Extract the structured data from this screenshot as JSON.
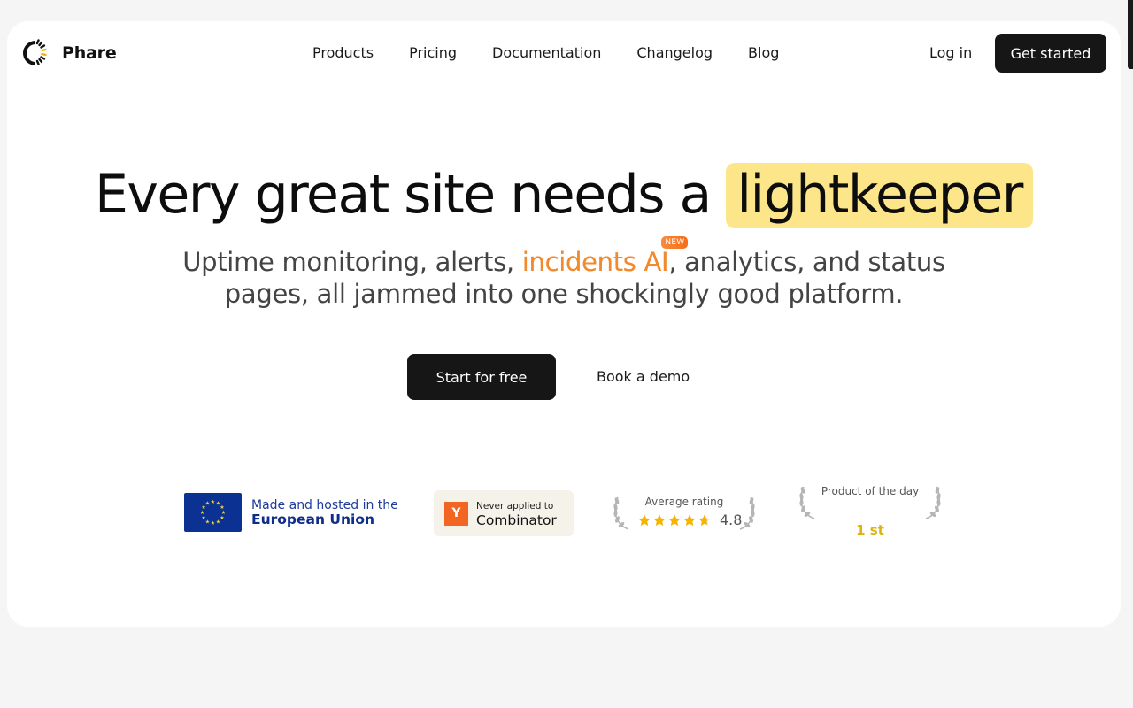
{
  "app": {
    "name": "Phare"
  },
  "nav": {
    "items": [
      {
        "label": "Products"
      },
      {
        "label": "Pricing"
      },
      {
        "label": "Documentation"
      },
      {
        "label": "Changelog"
      },
      {
        "label": "Blog"
      }
    ],
    "login_label": "Log in",
    "cta_label": "Get started"
  },
  "hero": {
    "title_prefix": "Every great site needs a",
    "title_highlight": "lightkeeper",
    "subtitle_part1": "Uptime monitoring, alerts,",
    "subtitle_incidents": "incidents AI",
    "new_badge": "NEW",
    "subtitle_part2": ", analytics, and status",
    "subtitle_line2": "pages, all jammed into one shockingly good platform.",
    "primary_button": "Start for free",
    "secondary_button": "Book a demo"
  },
  "badges": {
    "eu": {
      "line1": "Made and hosted in the",
      "line2": "European Union"
    },
    "yc": {
      "logo": "Y",
      "line1": "Never applied to",
      "line2": "Combinator"
    },
    "rating": {
      "label": "Average rating",
      "value": "4.8",
      "stars": 4.8
    },
    "product_of_day": {
      "label": "Product of the day",
      "rank": "1 st"
    }
  },
  "colors": {
    "highlight": "#fde68a",
    "accent_orange": "#f08a2c",
    "button_dark": "#161616",
    "eu_blue": "#0b3293",
    "yc_orange": "#f26522",
    "star_gold": "#f4b400",
    "rank_gold": "#e0b40a"
  },
  "icons": {
    "logo": "lighthouse-beam-icon",
    "eu": "eu-flag-icon",
    "yc": "y-combinator-icon",
    "laurel": "laurel-icon",
    "star": "star-icon"
  }
}
